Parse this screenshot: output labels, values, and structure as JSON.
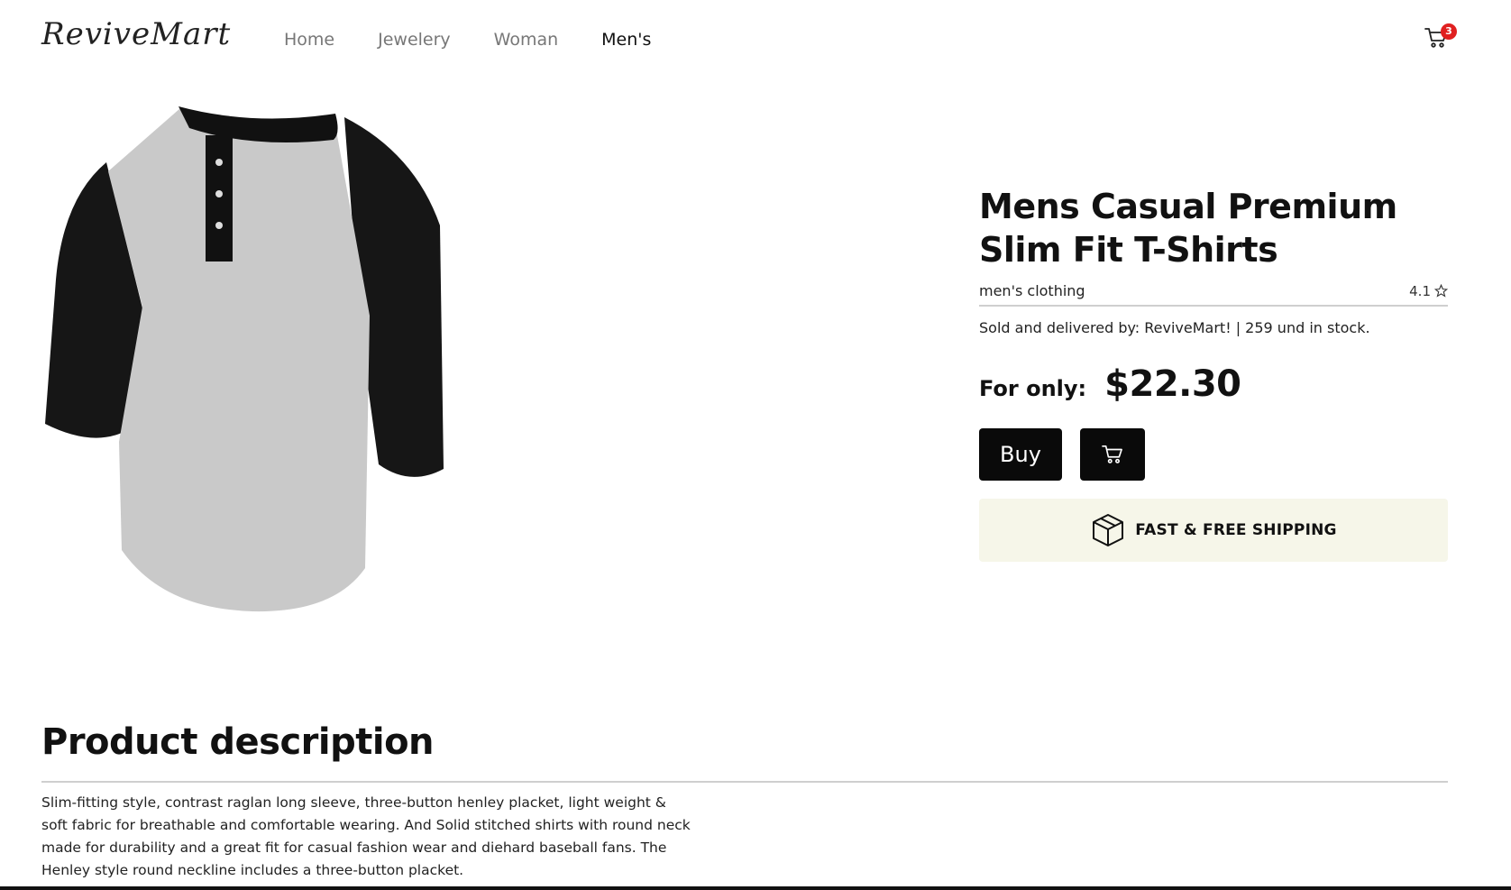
{
  "brand": {
    "logo_text": "ReviveMart"
  },
  "nav": {
    "items": [
      {
        "label": "Home"
      },
      {
        "label": "Jewelery"
      },
      {
        "label": "Woman"
      },
      {
        "label": "Men's",
        "active": true
      }
    ]
  },
  "cart": {
    "icon": "cart-icon",
    "badge_count": "3",
    "badge_color": "#e02020"
  },
  "product": {
    "title": "Mens Casual Premium Slim Fit T-Shirts",
    "category": "men's clothing",
    "rating": "4.1",
    "rating_icon": "star-icon",
    "seller_info": "Sold and delivered by: ReviveMart! | 259 und in stock.",
    "price_label": "For only:",
    "price": "$22.30",
    "buy_label": "Buy",
    "add_to_cart_icon": "cart-icon",
    "shipping_label": "FAST & FREE SHIPPING",
    "shipping_icon": "box-icon",
    "image_description": "raglan henley shirt, grey body with black sleeves"
  },
  "description": {
    "heading": "Product description",
    "text": "Slim-fitting style, contrast raglan long sleeve, three-button henley placket, light weight & soft fabric for breathable and comfortable wearing. And Solid stitched shirts with round neck made for durability and a great fit for casual fashion wear and diehard baseball fans. The Henley style round neckline includes a three-button placket."
  },
  "colors": {
    "button_bg": "#0a0a0a",
    "shipping_bg": "#f6f6e9",
    "nav_inactive": "#777777",
    "nav_active": "#111111"
  }
}
